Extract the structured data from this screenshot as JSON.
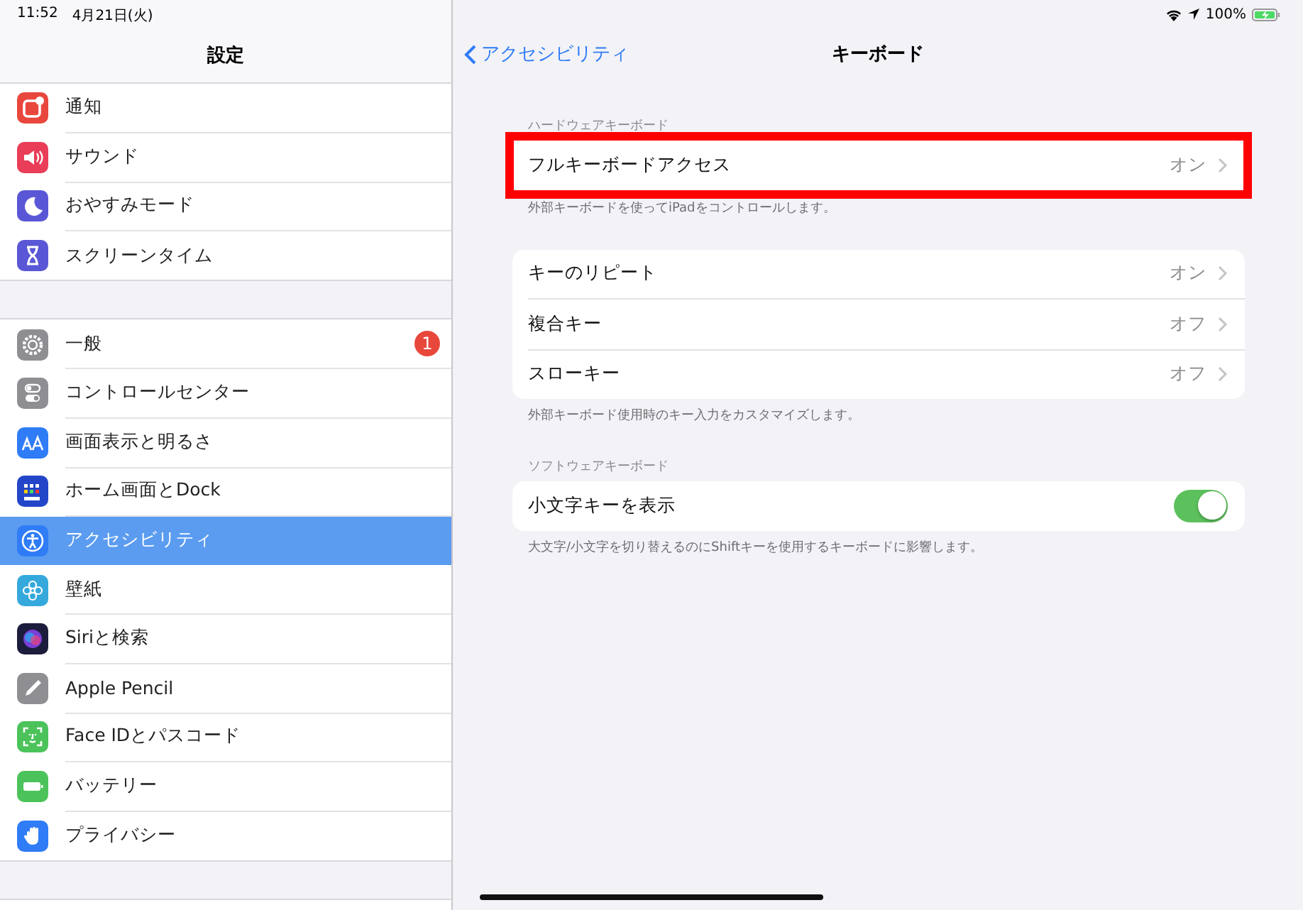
{
  "status_bar": {
    "time": "11:52",
    "date": "4月21日(火)",
    "battery": "100%"
  },
  "sidebar": {
    "title": "設定",
    "groups": [
      [
        {
          "label": "通知",
          "selected": false
        },
        {
          "label": "サウンド",
          "selected": false
        },
        {
          "label": "おやすみモード",
          "selected": false
        },
        {
          "label": "スクリーンタイム",
          "selected": false
        }
      ],
      [
        {
          "label": "一般",
          "selected": false,
          "badge": "1"
        },
        {
          "label": "コントロールセンター",
          "selected": false
        },
        {
          "label": "画面表示と明るさ",
          "selected": false
        },
        {
          "label": "ホーム画面とDock",
          "selected": false
        },
        {
          "label": "アクセシビリティ",
          "selected": true
        },
        {
          "label": "壁紙",
          "selected": false
        },
        {
          "label": "Siriと検索",
          "selected": false
        },
        {
          "label": "Apple Pencil",
          "selected": false
        },
        {
          "label": "Face IDとパスコード",
          "selected": false
        },
        {
          "label": "バッテリー",
          "selected": false
        },
        {
          "label": "プライバシー",
          "selected": false
        }
      ]
    ]
  },
  "detail": {
    "back": "アクセシビリティ",
    "title": "キーボード",
    "sections": [
      {
        "header": "ハードウェアキーボード",
        "highlighted": true,
        "rows": [
          {
            "kind": "link",
            "label": "フルキーボードアクセス",
            "value": "オン"
          }
        ],
        "footer": "外部キーボードを使ってiPadをコントロールします。"
      },
      {
        "highlighted": false,
        "rows": [
          {
            "kind": "link",
            "label": "キーのリピート",
            "value": "オン"
          },
          {
            "kind": "link",
            "label": "複合キー",
            "value": "オフ"
          },
          {
            "kind": "link",
            "label": "スローキー",
            "value": "オフ"
          }
        ],
        "footer": "外部キーボード使用時のキー入力をカスタマイズします。"
      },
      {
        "header": "ソフトウェアキーボード",
        "highlighted": false,
        "rows": [
          {
            "kind": "toggle",
            "label": "小文字キーを表示",
            "on": true
          }
        ],
        "footer": "大文字/小文字を切り替えるのにShiftキーを使用するキーボードに影響します。"
      }
    ]
  }
}
